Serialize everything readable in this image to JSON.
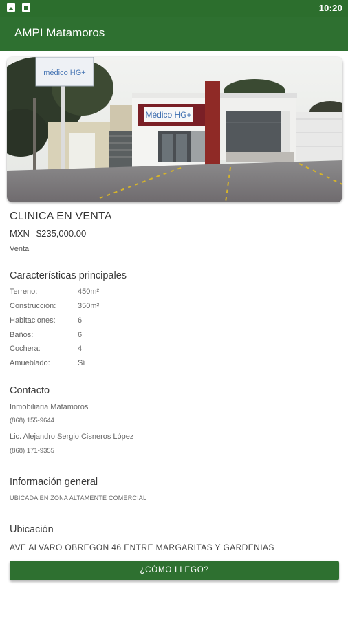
{
  "status_bar": {
    "time": "10:20",
    "icons": [
      "image-notification-icon",
      "download-notification-icon"
    ]
  },
  "app_bar": {
    "title": "AMPI Matamoros"
  },
  "photo": {
    "sign_text": "Médico HG+",
    "description_icon": "building-photo"
  },
  "property": {
    "title": "CLINICA EN VENTA",
    "currency": "MXN",
    "price": "$235,000.00",
    "operation": "Venta"
  },
  "features": {
    "heading": "Características principales",
    "items": [
      {
        "label": "Terreno:",
        "value": "450m²"
      },
      {
        "label": "Construcción:",
        "value": "350m²"
      },
      {
        "label": "Habitaciones:",
        "value": "6"
      },
      {
        "label": "Baños:",
        "value": "6"
      },
      {
        "label": "Cochera:",
        "value": "4"
      },
      {
        "label": "Amueblado:",
        "value": "Sí"
      }
    ]
  },
  "contact": {
    "heading": "Contacto",
    "company": "Inmobiliaria Matamoros",
    "company_phone": "(868) 155-9644",
    "agent": "Lic. Alejandro Sergio Cisneros López",
    "agent_phone": "(868) 171-9355"
  },
  "general": {
    "heading": "Información general",
    "text": "UBICADA EN ZONA ALTAMENTE COMERCIAL"
  },
  "location": {
    "heading": "Ubicación",
    "address": "AVE ALVARO OBREGON 46 ENTRE MARGARITAS Y GARDENIAS",
    "directions_button": "¿CÓMO LLEGO?"
  },
  "colors": {
    "primary": "#2e7030",
    "status_bar": "#2c6e2d"
  }
}
